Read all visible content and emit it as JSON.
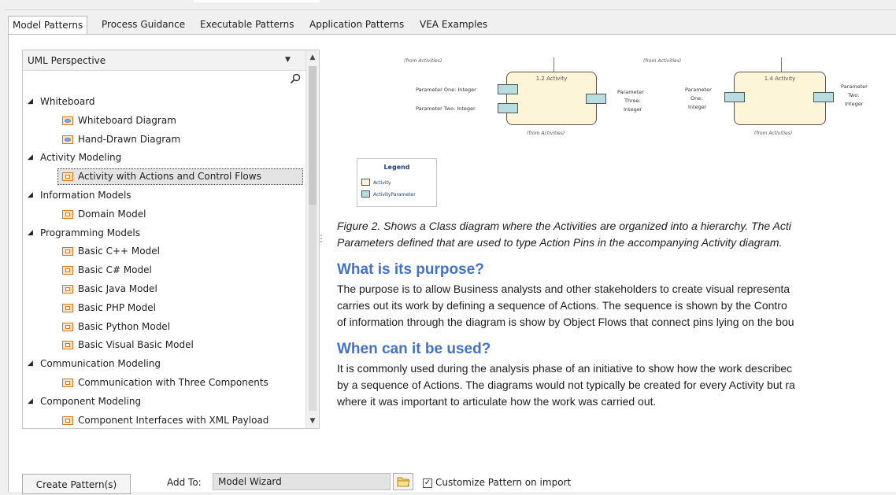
{
  "tabs": [
    "Model Patterns",
    "Process Guidance",
    "Executable Patterns",
    "Application Patterns",
    "VEA Examples"
  ],
  "left": {
    "perspective": "UML Perspective",
    "tree": [
      {
        "type": "group",
        "label": "Whiteboard"
      },
      {
        "type": "leaf",
        "label": "Whiteboard Diagram",
        "icon": "oval"
      },
      {
        "type": "leaf",
        "label": "Hand-Drawn Diagram",
        "icon": "oval"
      },
      {
        "type": "group",
        "label": "Activity Modeling"
      },
      {
        "type": "leaf",
        "label": "Activity with Actions and Control Flows",
        "icon": "box",
        "selected": true
      },
      {
        "type": "group",
        "label": "Information Models"
      },
      {
        "type": "leaf",
        "label": "Domain Model",
        "icon": "box"
      },
      {
        "type": "group",
        "label": "Programming Models"
      },
      {
        "type": "leaf",
        "label": "Basic C++ Model",
        "icon": "box"
      },
      {
        "type": "leaf",
        "label": "Basic C# Model",
        "icon": "box"
      },
      {
        "type": "leaf",
        "label": "Basic Java Model",
        "icon": "box"
      },
      {
        "type": "leaf",
        "label": "Basic PHP Model",
        "icon": "box"
      },
      {
        "type": "leaf",
        "label": "Basic Python Model",
        "icon": "box"
      },
      {
        "type": "leaf",
        "label": "Basic Visual Basic Model",
        "icon": "box"
      },
      {
        "type": "group",
        "label": "Communication Modeling"
      },
      {
        "type": "leaf",
        "label": "Communication with Three Components",
        "icon": "box"
      },
      {
        "type": "group",
        "label": "Component Modeling"
      },
      {
        "type": "leaf",
        "label": "Component Interfaces with XML Payload",
        "icon": "box"
      }
    ]
  },
  "diagram": {
    "from": "(from Activities)",
    "act1": {
      "title": "1.2 Activity",
      "p1": "Parameter One: Integer",
      "p2": "Parameter Two: Integer",
      "p3a": "Parameter",
      "p3b": "Three:",
      "p3c": "Integer"
    },
    "act2": {
      "title": "1.4 Activity",
      "p1a": "Parameter",
      "p1b": "One:",
      "p1c": "Integer",
      "p2a": "Parameter",
      "p2b": "Two:",
      "p2c": "Integer"
    },
    "legend": {
      "title": "Legend",
      "item1": "Activity",
      "item2": "ActivityParameter"
    }
  },
  "doc": {
    "caption1": "Figure 2. Shows a Class diagram where the Activities are organized into a hierarchy. The Acti",
    "caption2": "Parameters defined that are used to type Action Pins in the accompanying Activity diagram.",
    "h1": "What is its purpose?",
    "p1a": "The purpose is to allow Business analysts and other stakeholders to create visual representa",
    "p1b": "carries out its work by defining a sequence of Actions.  The sequence is shown by the Contro",
    "p1c": "of information through the diagram is show by Object Flows that connect pins lying on the bou",
    "h2": "When can it be used?",
    "p2a": "It is commonly used during the analysis phase of an initiative to show how the work describec",
    "p2b": "by a sequence of Actions. The diagrams would not typically be created for every Activity but ra",
    "p2c": "where it was important to articulate how the work was carried out."
  },
  "bottom": {
    "create": "Create Pattern(s)",
    "add_to": "Add To:",
    "add_to_value": "Model Wizard",
    "customize": "Customize Pattern on import"
  }
}
